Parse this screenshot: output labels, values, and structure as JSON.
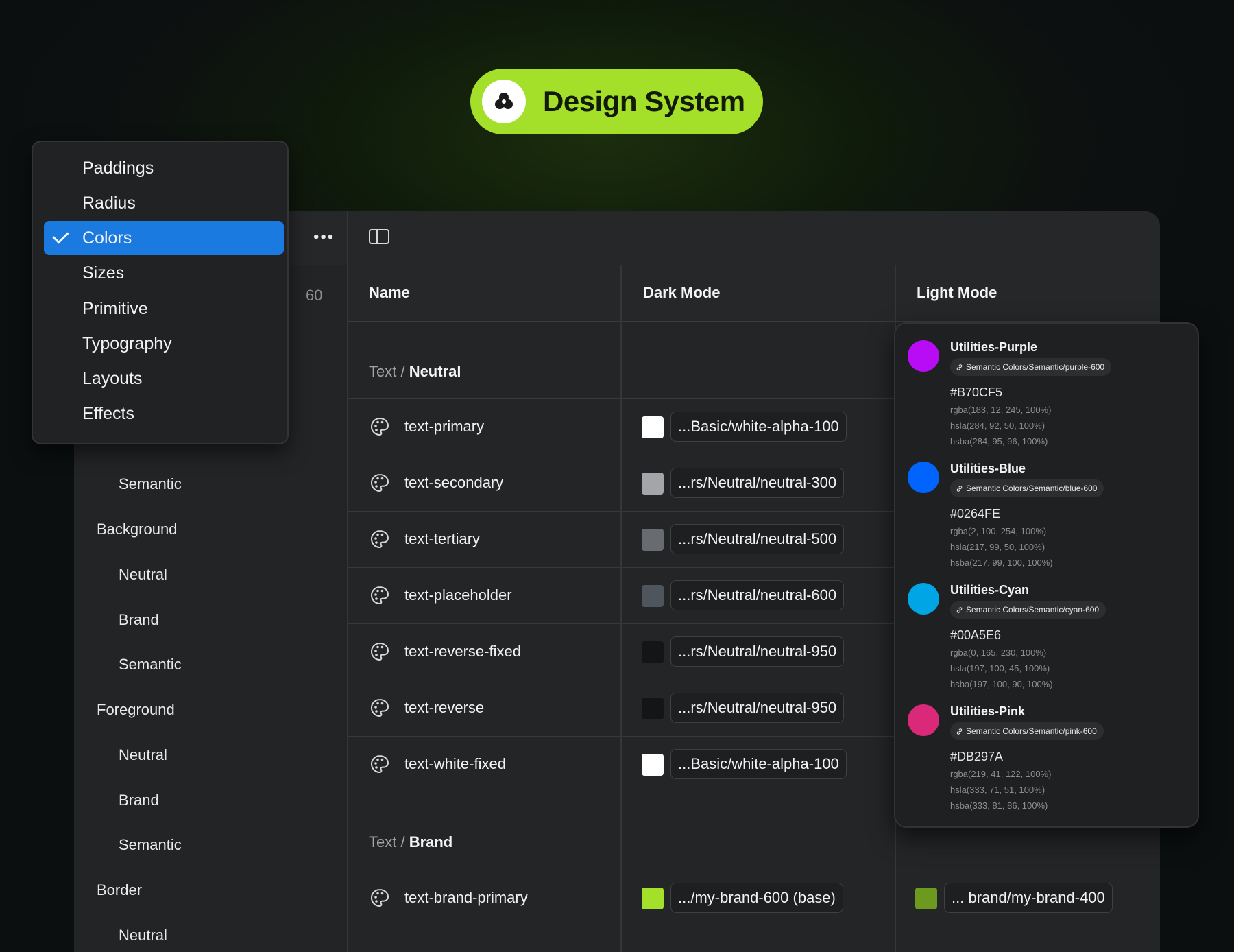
{
  "badge": {
    "title": "Design System",
    "icon": "circles-icon"
  },
  "toolbar": {
    "more_icon": "more-horizontal-icon",
    "panel_icon": "sidebar-panel-icon",
    "count": "60"
  },
  "table_header": {
    "name": "Name",
    "dark": "Dark Mode",
    "light": "Light Mode"
  },
  "menu": {
    "items": [
      "Paddings",
      "Radius",
      "Colors",
      "Sizes",
      "Primitive",
      "Typography",
      "Layouts",
      "Effects"
    ],
    "selected": "Colors"
  },
  "tree": [
    {
      "label": "Semantic",
      "level": 2
    },
    {
      "label": "Background",
      "level": 1
    },
    {
      "label": "Neutral",
      "level": 2
    },
    {
      "label": "Brand",
      "level": 2
    },
    {
      "label": "Semantic",
      "level": 2
    },
    {
      "label": "Foreground",
      "level": 1
    },
    {
      "label": "Neutral",
      "level": 2
    },
    {
      "label": "Brand",
      "level": 2
    },
    {
      "label": "Semantic",
      "level": 2
    },
    {
      "label": "Border",
      "level": 1
    },
    {
      "label": "Neutral",
      "level": 2
    }
  ],
  "groups": [
    {
      "prefix": "Text / ",
      "name": "Neutral"
    },
    {
      "prefix": "Text / ",
      "name": "Brand"
    }
  ],
  "rows": [
    {
      "name": "text-primary",
      "dark_color": "#ffffff",
      "dark_ref": "...Basic/white-alpha-100"
    },
    {
      "name": "text-secondary",
      "dark_color": "#a3a5a8",
      "dark_ref": "...rs/Neutral/neutral-300"
    },
    {
      "name": "text-tertiary",
      "dark_color": "#686b70",
      "dark_ref": "...rs/Neutral/neutral-500"
    },
    {
      "name": "text-placeholder",
      "dark_color": "#4f555c",
      "dark_ref": "...rs/Neutral/neutral-600"
    },
    {
      "name": "text-reverse-fixed",
      "dark_color": "#141516",
      "dark_ref": "...rs/Neutral/neutral-950"
    },
    {
      "name": "text-reverse",
      "dark_color": "#141516",
      "dark_ref": "...rs/Neutral/neutral-950"
    },
    {
      "name": "text-white-fixed",
      "dark_color": "#ffffff",
      "dark_ref": "...Basic/white-alpha-100"
    }
  ],
  "brand_row": {
    "name": "text-brand-primary",
    "dark_color": "#a4e02a",
    "dark_ref": ".../my-brand-600 (base)",
    "light_color": "#6b9a1e",
    "light_ref": "... brand/my-brand-400"
  },
  "utilities": [
    {
      "name": "Utilities-Purple",
      "tag": "Semantic Colors/Semantic/purple-600",
      "hex": "#B70CF5",
      "color": "#b70cf5",
      "rgba": "rgba(183, 12, 245, 100%)",
      "hsla": "hsla(284, 92, 50, 100%)",
      "hsba": "hsba(284, 95, 96, 100%)"
    },
    {
      "name": "Utilities-Blue",
      "tag": "Semantic Colors/Semantic/blue-600",
      "hex": "#0264FE",
      "color": "#0264fe",
      "rgba": "rgba(2, 100, 254, 100%)",
      "hsla": "hsla(217, 99, 50, 100%)",
      "hsba": "hsba(217, 99, 100, 100%)"
    },
    {
      "name": "Utilities-Cyan",
      "tag": "Semantic Colors/Semantic/cyan-600",
      "hex": "#00A5E6",
      "color": "#00a5e6",
      "rgba": "rgba(0, 165, 230, 100%)",
      "hsla": "hsla(197, 100, 45, 100%)",
      "hsba": "hsba(197, 100, 90, 100%)"
    },
    {
      "name": "Utilities-Pink",
      "tag": "Semantic Colors/Semantic/pink-600",
      "hex": "#DB297A",
      "color": "#db297a",
      "rgba": "rgba(219, 41, 122, 100%)",
      "hsla": "hsla(333, 71, 51, 100%)",
      "hsba": "hsba(333, 81, 86, 100%)"
    }
  ],
  "colors": {
    "accent": "#a4e02a",
    "selection": "#1b7ae0"
  }
}
